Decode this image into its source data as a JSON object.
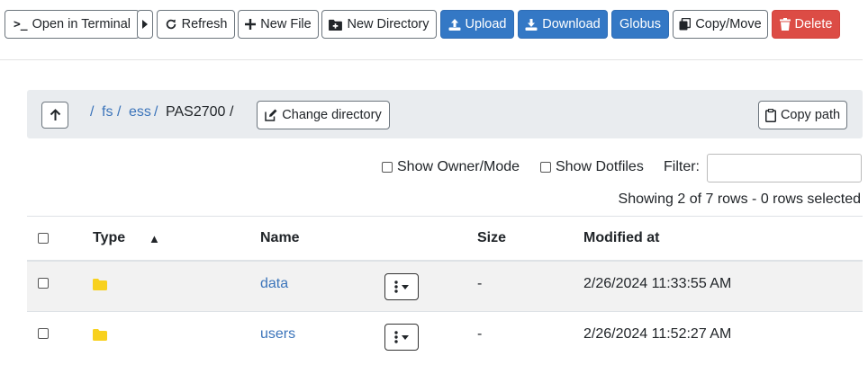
{
  "toolbar": {
    "open_terminal": "Open in Terminal",
    "refresh": "Refresh",
    "new_file": "New File",
    "new_directory": "New Directory",
    "upload": "Upload",
    "download": "Download",
    "globus": "Globus",
    "copy_move": "Copy/Move",
    "delete": "Delete"
  },
  "breadcrumb": {
    "sep": "/",
    "parts": [
      "fs",
      "ess",
      "PAS2700"
    ],
    "change_directory": "Change directory",
    "copy_path": "Copy path"
  },
  "options": {
    "show_owner_mode": "Show Owner/Mode",
    "show_dotfiles": "Show Dotfiles",
    "filter_label": "Filter:",
    "filter_value": ""
  },
  "summary": "Showing 2 of 7 rows - 0 rows selected",
  "table": {
    "headers": {
      "type": "Type",
      "name": "Name",
      "size": "Size",
      "modified": "Modified at"
    },
    "sort_indicator": "▲",
    "rows": [
      {
        "name": "data",
        "size": "-",
        "modified": "2/26/2024 11:33:55 AM"
      },
      {
        "name": "users",
        "size": "-",
        "modified": "2/26/2024 11:52:27 AM"
      }
    ]
  },
  "colors": {
    "primary": "#3478c5",
    "danger": "#dc4c45",
    "link": "#3b74ba",
    "folder": "#f8d11e"
  },
  "icons": {
    "terminal": "terminal-icon",
    "refresh": "refresh-icon",
    "plus": "plus-icon",
    "folder_plus": "folder-plus-icon",
    "upload": "upload-icon",
    "download": "download-icon",
    "copy": "copy-icon",
    "trash": "trash-icon",
    "up_arrow": "arrow-up-icon",
    "edit": "edit-icon",
    "clipboard": "clipboard-icon",
    "folder": "folder-icon",
    "menu": "vertical-dots-icon"
  }
}
